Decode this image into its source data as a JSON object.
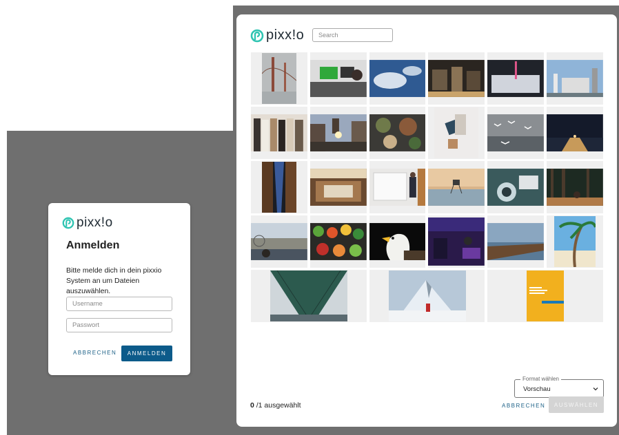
{
  "login": {
    "brand": "pixx!o",
    "title": "Anmelden",
    "description": "Bitte melde dich in dein pixxio System an um Dateien auszuwählen.",
    "username_placeholder": "Username",
    "password_placeholder": "Passwort",
    "cancel_label": "ABBRECHEN",
    "login_label": "ANMELDEN"
  },
  "picker": {
    "brand": "pixx!o",
    "search_placeholder": "Search",
    "format_label": "Format wählen",
    "format_value": "Vorschau",
    "selected_count": "0",
    "selected_suffix": " /1 ausgewählt",
    "cancel_label": "ABBRECHEN",
    "select_label": "AUSWÄHLEN"
  },
  "thumbnails": [
    "bridge-fog-photo",
    "office-desk-photo",
    "clouds-aerial-photo",
    "factory-interior-photo",
    "lab-pipette-photo",
    "industrial-plant-photo",
    "clothes-rack-photo",
    "city-street-photo",
    "food-bowls-photo",
    "flatlay-clothes-photo",
    "seagulls-photo",
    "pier-night-photo",
    "alley-photo",
    "conference-hall-photo",
    "whiteboard-person-photo",
    "lifeguard-tower-photo",
    "camera-lens-photo",
    "forest-person-photo",
    "harbor-city-photo",
    "vegetables-photo",
    "eagle-photo",
    "dj-stage-photo",
    "jetty-sunset-photo",
    "palm-beach-photo",
    "bridge-underside-photo",
    "mountain-hiker-photo",
    "yellow-brochure-cover"
  ],
  "colors": {
    "accent": "#0c5b8a",
    "logo_teal": "#2fc4b2",
    "backdrop": "#6f6f6f",
    "disabled": "#d4d4d4"
  }
}
